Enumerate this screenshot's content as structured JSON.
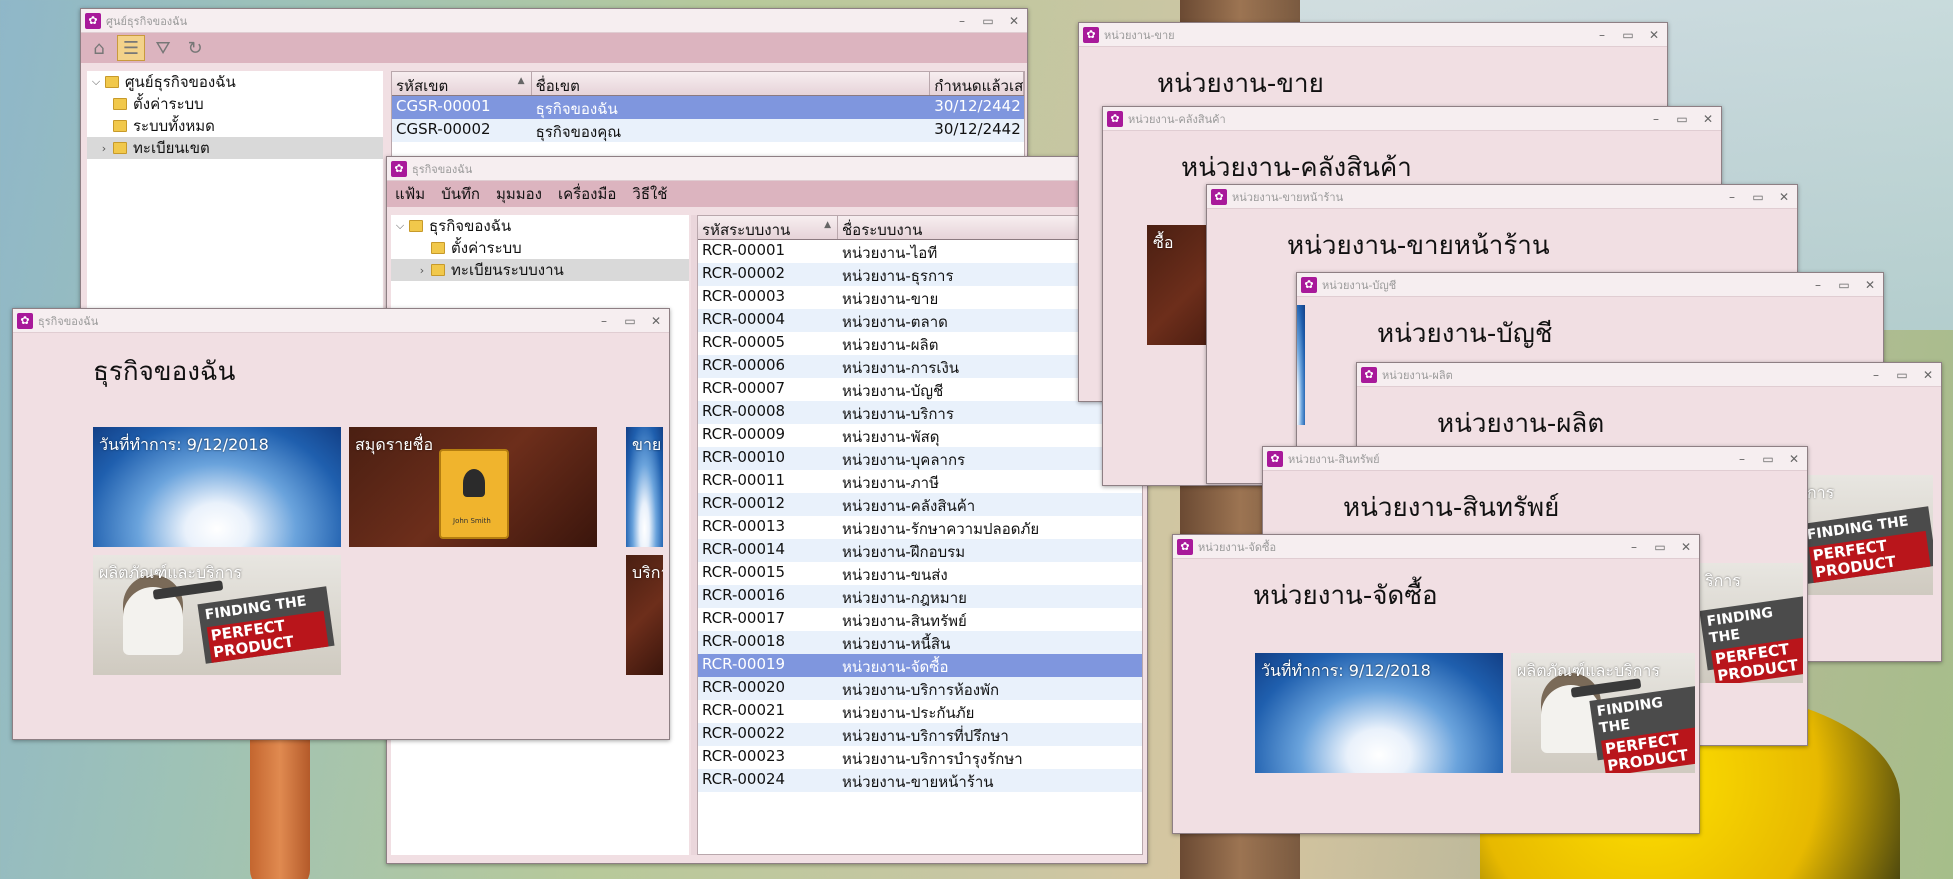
{
  "desktop": {},
  "win_center": {
    "title": "ศูนย์ธุรกิจของฉัน",
    "tree": [
      "ศูนย์ธุรกิจของฉัน",
      "ตั้งค่าระบบ",
      "ระบบทั้งหมด",
      "ทะเบียนเขต"
    ],
    "grid": {
      "columns": [
        "รหัสเขต",
        "ชื่อเขต",
        "กำหนดแล้วเส"
      ],
      "rows": [
        [
          "CGSR-00001",
          "ธุรกิจของฉัน",
          "30/12/2442"
        ],
        [
          "CGSR-00002",
          "ธุรกิจของคุณ",
          "30/12/2442"
        ]
      ]
    }
  },
  "win_business": {
    "title": "ธุรกิจของฉัน",
    "menu": [
      "แฟ้ม",
      "บันทึก",
      "มุมมอง",
      "เครื่องมือ",
      "วิธีใช้"
    ],
    "tree": [
      "ธุรกิจของฉัน",
      "ตั้งค่าระบบ",
      "ทะเบียนระบบงาน"
    ],
    "grid": {
      "columns": [
        "รหัสระบบงาน",
        "ชื่อระบบงาน"
      ],
      "rows": [
        [
          "RCR-00001",
          "หน่วยงาน-ไอที"
        ],
        [
          "RCR-00002",
          "หน่วยงาน-ธุรการ"
        ],
        [
          "RCR-00003",
          "หน่วยงาน-ขาย"
        ],
        [
          "RCR-00004",
          "หน่วยงาน-ตลาด"
        ],
        [
          "RCR-00005",
          "หน่วยงาน-ผลิต"
        ],
        [
          "RCR-00006",
          "หน่วยงาน-การเงิน"
        ],
        [
          "RCR-00007",
          "หน่วยงาน-บัญชี"
        ],
        [
          "RCR-00008",
          "หน่วยงาน-บริการ"
        ],
        [
          "RCR-00009",
          "หน่วยงาน-พัสดุ"
        ],
        [
          "RCR-00010",
          "หน่วยงาน-บุคลากร"
        ],
        [
          "RCR-00011",
          "หน่วยงาน-ภาษี"
        ],
        [
          "RCR-00012",
          "หน่วยงาน-คลังสินค้า"
        ],
        [
          "RCR-00013",
          "หน่วยงาน-รักษาความปลอดภัย"
        ],
        [
          "RCR-00014",
          "หน่วยงาน-ฝึกอบรม"
        ],
        [
          "RCR-00015",
          "หน่วยงาน-ขนส่ง"
        ],
        [
          "RCR-00016",
          "หน่วยงาน-กฎหมาย"
        ],
        [
          "RCR-00017",
          "หน่วยงาน-สินทรัพย์"
        ],
        [
          "RCR-00018",
          "หน่วยงาน-หนี้สิน"
        ],
        [
          "RCR-00019",
          "หน่วยงาน-จัดซื้อ"
        ],
        [
          "RCR-00020",
          "หน่วยงาน-บริการห้องพัก"
        ],
        [
          "RCR-00021",
          "หน่วยงาน-ประกันภัย"
        ],
        [
          "RCR-00022",
          "หน่วยงาน-บริการที่ปรึกษา"
        ],
        [
          "RCR-00023",
          "หน่วยงาน-บริการบำรุงรักษา"
        ],
        [
          "RCR-00024",
          "หน่วยงาน-ขายหน้าร้าน"
        ]
      ],
      "selected_index": 18
    }
  },
  "win_dash": {
    "title": "ธุรกิจของฉัน",
    "heading": "ธุรกิจของฉัน",
    "tile_date": "วันที่ทำการ: 9/12/2018",
    "tile_contacts": "สมุดรายชื่อ",
    "tile_products": "ผลิตภัณฑ์และบริการ",
    "tile_cut1": "ขาย",
    "tile_cut2": "บริการ",
    "book_name": "John Smith",
    "banner_line1": "FINDING THE",
    "banner_line2": "PERFECT PRODUCT"
  },
  "win_sales": {
    "title": "หน่วยงาน-ขาย",
    "heading": "หน่วยงาน-ขาย"
  },
  "win_warehouse": {
    "title": "หน่วยงาน-คลังสินค้า",
    "heading": "หน่วยงาน-คลังสินค้า",
    "tile": "ซื้อ"
  },
  "win_store": {
    "title": "หน่วยงาน-ขายหน้าร้าน",
    "heading": "หน่วยงาน-ขายหน้าร้าน"
  },
  "win_account": {
    "title": "หน่วยงาน-บัญชี",
    "heading": "หน่วยงาน-บัญชี"
  },
  "win_produce": {
    "title": "หน่วยงาน-ผลิต",
    "heading": "หน่วยงาน-ผลิต",
    "tile": "การ"
  },
  "win_asset": {
    "title": "หน่วยงาน-สินทรัพย์",
    "heading": "หน่วยงาน-สินทรัพย์",
    "tile": "ริการ"
  },
  "win_purchase": {
    "title": "หน่วยงาน-จัดซื้อ",
    "heading": "หน่วยงาน-จัดซื้อ",
    "tile_date": "วันที่ทำการ: 9/12/2018",
    "tile_products": "ผลิตภัณฑ์และบริการ"
  },
  "window_controls": {
    "minimize": "–",
    "maximize": "▭",
    "close": "✕"
  },
  "colors": {
    "window_bg": "#f1dfe3",
    "toolbar": "#dcb4bf",
    "selection": "#7f96de",
    "app_icon": "#a8199a"
  }
}
